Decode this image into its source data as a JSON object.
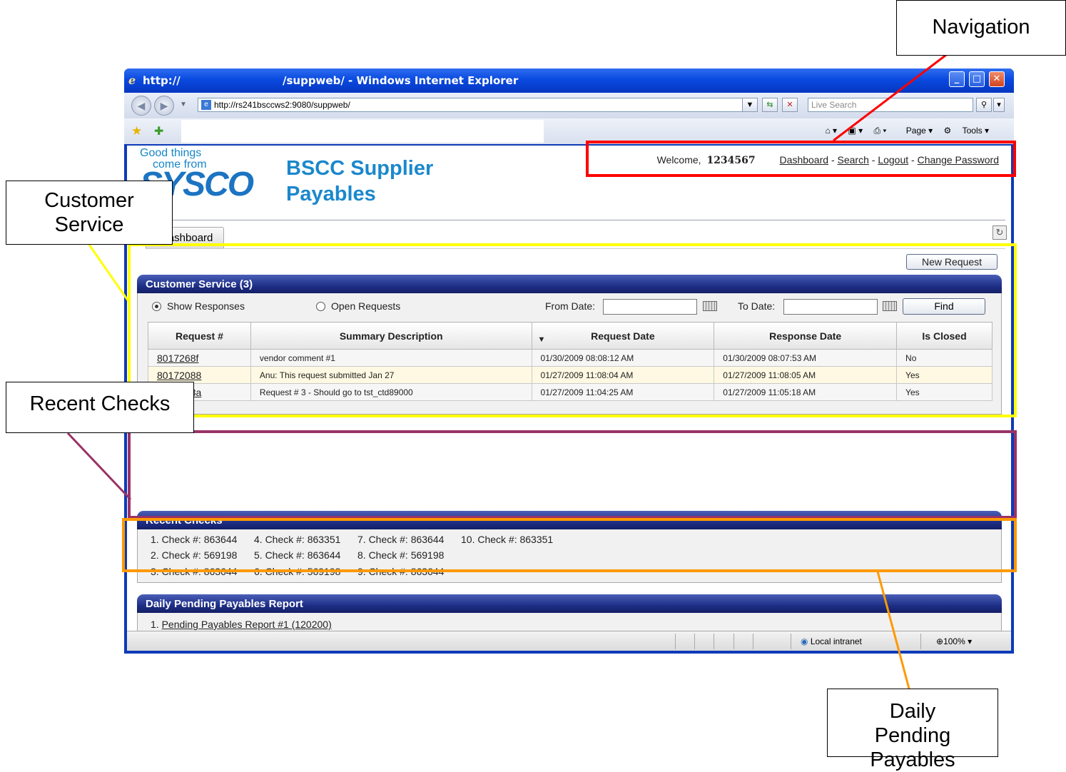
{
  "window": {
    "title_left": "http://",
    "title_right": "/suppweb/ - Windows Internet Explorer",
    "url": "http://rs241bsccws2:9080/suppweb/",
    "search_placeholder": "Live Search",
    "commands": [
      "Page",
      "Tools"
    ]
  },
  "logo": {
    "tagline_1": "Good things",
    "tagline_2": "come from",
    "wordmark": "SYSCO"
  },
  "app": {
    "title_line1": "BSCC Supplier",
    "title_line2": "Payables"
  },
  "nav": {
    "welcome": "Welcome,",
    "user_id": "1234567",
    "links": [
      "Dashboard",
      "Search",
      "Logout",
      "Change Password"
    ],
    "separator": "-"
  },
  "tab": {
    "label": "Dashboard"
  },
  "new_request": "New Request",
  "customer_service": {
    "title": "Customer Service (3)",
    "filter_show_responses": "Show Responses",
    "filter_open_requests": "Open Requests",
    "from_date_label": "From Date:",
    "to_date_label": "To Date:",
    "find_label": "Find",
    "columns": [
      "Request #",
      "Summary Description",
      "Request Date",
      "Response Date",
      "Is Closed"
    ],
    "rows": [
      {
        "request": "8017268f",
        "summary": "vendor comment #1",
        "request_date": "01/30/2009 08:08:12 AM",
        "response_date": "01/30/2009 08:07:53 AM",
        "closed": "No"
      },
      {
        "request": "80172088",
        "summary": "Anu: This request submitted Jan 27",
        "request_date": "01/27/2009 11:08:04 AM",
        "response_date": "01/27/2009 11:08:05 AM",
        "closed": "Yes"
      },
      {
        "request": "8017203a",
        "summary": "Request # 3 - Should go to tst_ctd89000",
        "request_date": "01/27/2009 11:04:25 AM",
        "response_date": "01/27/2009 11:05:18 AM",
        "closed": "Yes"
      }
    ]
  },
  "recent_checks": {
    "title": "Recent Checks",
    "items": [
      "1. Check #: 863644",
      "2. Check #: 569198",
      "3. Check #: 863644",
      "4. Check #: 863351",
      "5. Check #: 863644",
      "6. Check #: 569198",
      "7. Check #: 863644",
      "8. Check #: 569198",
      "9. Check #: 863644",
      "10. Check #: 863351"
    ]
  },
  "daily_pending": {
    "title": "Daily Pending Payables Report",
    "item_number": "1.",
    "item_link": "Pending Payables Report #1 (120200)"
  },
  "status": {
    "zone": "Local intranet",
    "zoom": "100%"
  },
  "callouts": {
    "navigation": "Navigation",
    "customer_service": "Customer Service",
    "recent_checks": "Recent Checks",
    "daily_pending": "Daily Pending Payables"
  },
  "colors": {
    "navigation": "#ff0000",
    "customer_service": "#ffff00",
    "recent_checks": "#993366",
    "daily_pending": "#ff9900",
    "portlet_header": "#1e2f86"
  }
}
